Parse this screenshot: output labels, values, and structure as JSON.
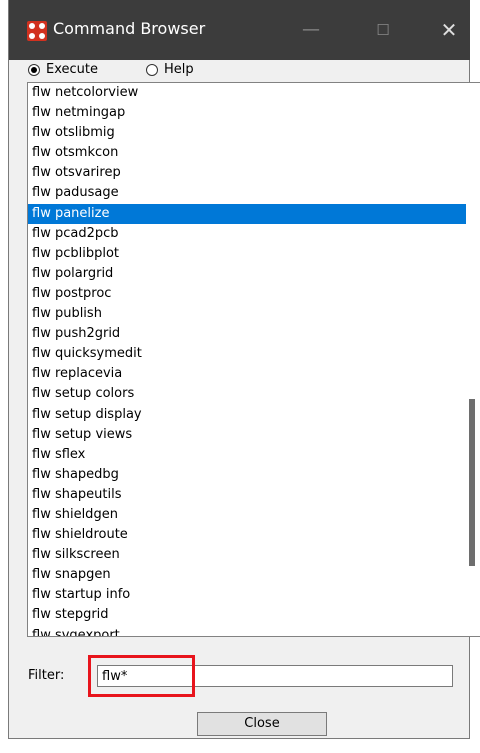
{
  "window": {
    "title": "Command Browser",
    "minimize_glyph": "—",
    "maximize_glyph": "☐",
    "close_glyph": "✕"
  },
  "mode": {
    "options": [
      {
        "label": "Execute",
        "selected": true
      },
      {
        "label": "Help",
        "selected": false
      }
    ]
  },
  "commands": [
    "flw netcolorview",
    "flw netmingap",
    "flw otslibmig",
    "flw otsmkcon",
    "flw otsvarirep",
    "flw padusage",
    "flw panelize",
    "flw pcad2pcb",
    "flw pcblibplot",
    "flw polargrid",
    "flw postproc",
    "flw publish",
    "flw push2grid",
    "flw quicksymedit",
    "flw replacevia",
    "flw setup colors",
    "flw setup display",
    "flw setup views",
    "flw sflex",
    "flw shapedbg",
    "flw shapeutils",
    "flw shieldgen",
    "flw shieldroute",
    "flw silkscreen",
    "flw snapgen",
    "flw startup info",
    "flw stepgrid",
    "flw svgexport"
  ],
  "selected_command": "flw panelize",
  "filter": {
    "label": "Filter:",
    "value": "flw*"
  },
  "buttons": {
    "close_label": "Close"
  },
  "colors": {
    "titlebar": "#3c3c3c",
    "selection": "#0078d7",
    "highlight_box": "#e8141c",
    "app_icon": "#d1311f"
  }
}
